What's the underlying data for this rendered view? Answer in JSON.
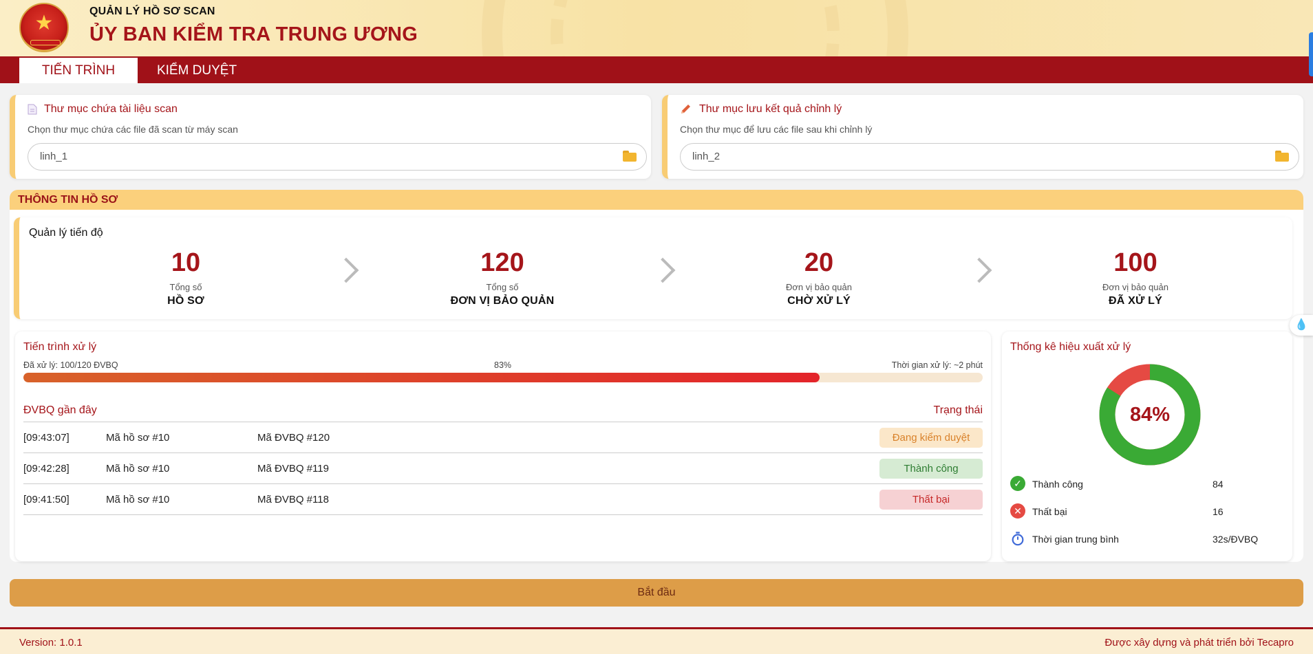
{
  "header": {
    "subtitle": "QUẢN LÝ HỒ SƠ SCAN",
    "title": "ỦY BAN KIỂM TRA TRUNG ƯƠNG"
  },
  "tabs": [
    {
      "label": "TIẾN TRÌNH",
      "active": true
    },
    {
      "label": "KIỂM DUYỆT",
      "active": false
    }
  ],
  "scan_folder": {
    "title": "Thư mục chứa tài liệu scan",
    "desc": "Chọn thư mục chứa các file đã scan từ máy scan",
    "value": "linh_1",
    "icon": "document-icon"
  },
  "result_folder": {
    "title": "Thư mục lưu kết quả chỉnh lý",
    "desc": "Chọn thư mục để lưu các file sau khi chỉnh lý",
    "value": "linh_2",
    "icon": "pencil-icon"
  },
  "section_title": "THÔNG TIN HỒ SƠ",
  "progress": {
    "title": "Quản lý tiến độ",
    "stats": [
      {
        "num": "10",
        "label": "Tổng số",
        "big": "HỒ SƠ"
      },
      {
        "num": "120",
        "label": "Tổng số",
        "big": "ĐƠN VỊ BẢO QUẢN"
      },
      {
        "num": "20",
        "label": "Đơn vị bảo quản",
        "big": "CHỜ XỬ LÝ"
      },
      {
        "num": "100",
        "label": "Đơn vị bảo quản",
        "big": "ĐÃ XỬ LÝ"
      }
    ]
  },
  "processing": {
    "title": "Tiến trình xử lý",
    "done_text": "Đã xử lý: 100/120 ĐVBQ",
    "percent_text": "83%",
    "percent": 83,
    "time_text": "Thời gian xử lý: ~2 phút",
    "recent_title": "ĐVBQ gần đây",
    "status_title": "Trạng thái",
    "rows": [
      {
        "time": "[09:43:07]",
        "hs": "Mã hồ sơ #10",
        "dv": "Mã ĐVBQ #120",
        "status": "Đang kiểm duyệt",
        "kind": "pending"
      },
      {
        "time": "[09:42:28]",
        "hs": "Mã hồ sơ #10",
        "dv": "Mã ĐVBQ #119",
        "status": "Thành công",
        "kind": "success"
      },
      {
        "time": "[09:41:50]",
        "hs": "Mã hồ sơ #10",
        "dv": "Mã ĐVBQ #118",
        "status": "Thất bại",
        "kind": "fail"
      }
    ]
  },
  "efficiency": {
    "title": "Thống kê hiệu xuất xử lý",
    "percent_label": "84%",
    "success_label": "Thành công",
    "success_value": "84",
    "fail_label": "Thất bại",
    "fail_value": "16",
    "avg_label": "Thời gian trung bình",
    "avg_value": "32s/ĐVBQ",
    "colors": {
      "success": "#3aaa35",
      "fail": "#e54a43"
    }
  },
  "start_label": "Bắt đầu",
  "footer": {
    "version": "Version: 1.0.1",
    "credit": "Được xây dựng và phát triển bởi Tecapro"
  }
}
